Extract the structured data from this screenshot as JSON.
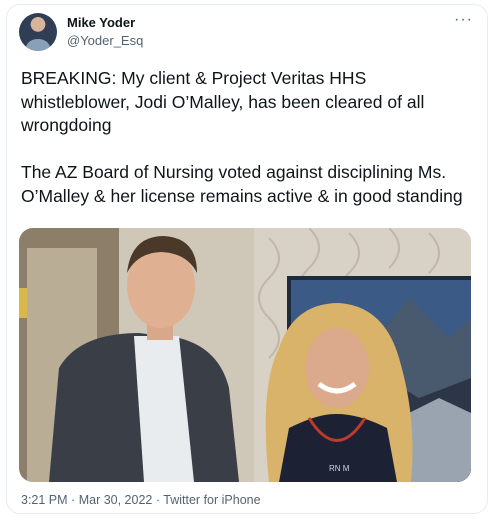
{
  "tweet": {
    "author": {
      "display_name": "Mike Yoder",
      "handle": "@Yoder_Esq"
    },
    "more_icon": "more-horizontal-icon",
    "text": "BREAKING: My client & Project Veritas HHS whistleblower, Jodi O’Malley, has been cleared of all wrongdoing\n\nThe AZ Board of Nursing voted against disciplining Ms. O’Malley & her license remains active & in good standing",
    "photo_shirt_text": "RN M",
    "time": "3:21 PM",
    "separator": "·",
    "date": "Mar 30, 2022",
    "source": "Twitter for iPhone"
  },
  "colors": {
    "text": "#0f1419",
    "secondary_text": "#536471",
    "border": "#e6ecf0"
  }
}
